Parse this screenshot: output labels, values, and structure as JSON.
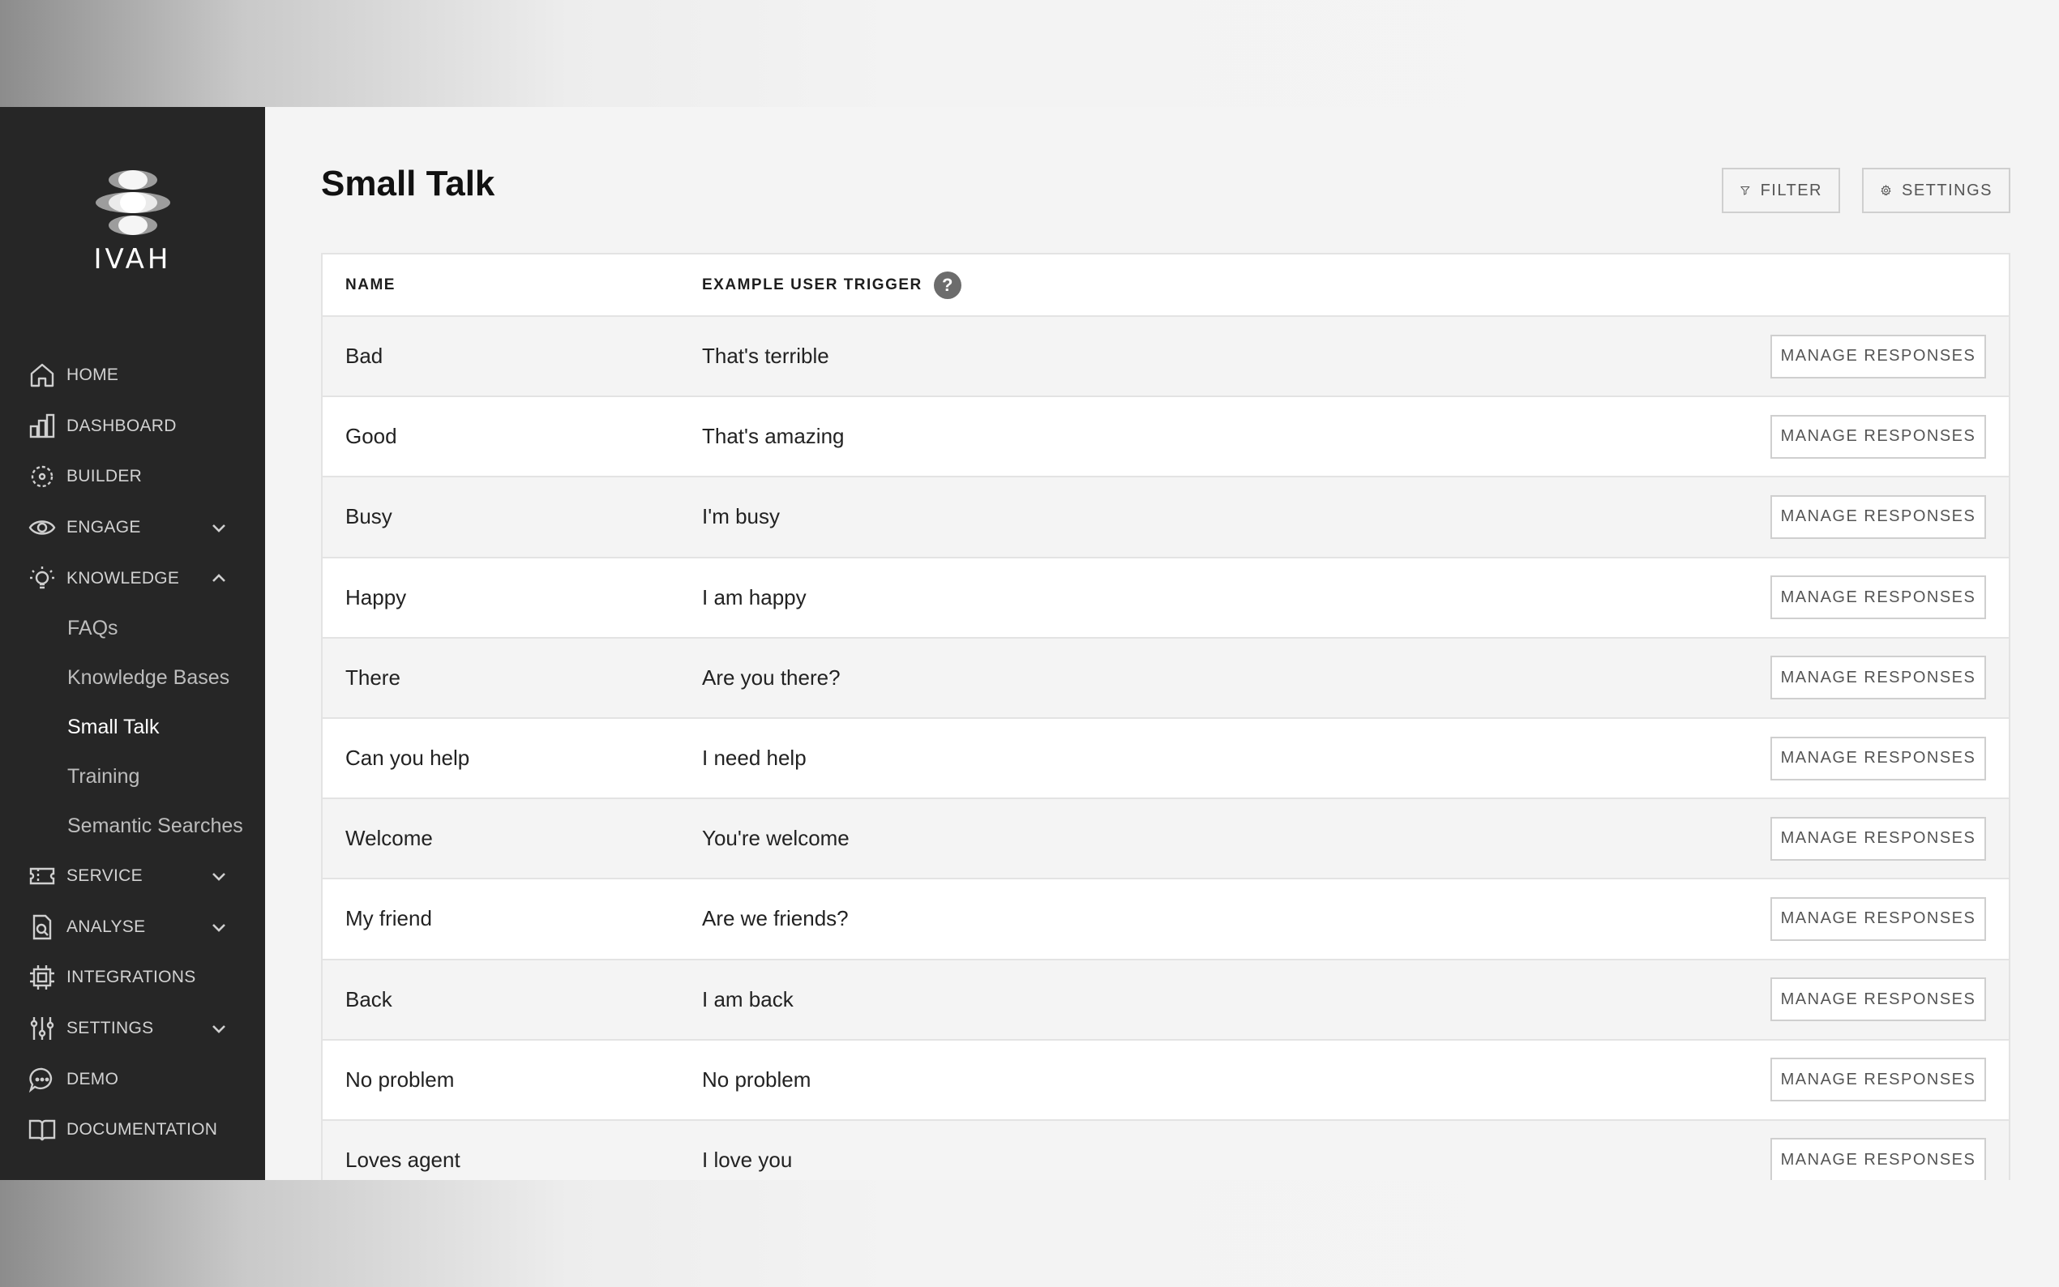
{
  "brand": {
    "name": "IVAH"
  },
  "sidebar": {
    "items": [
      {
        "label": "HOME",
        "icon": "home-icon"
      },
      {
        "label": "DASHBOARD",
        "icon": "bar-chart-icon"
      },
      {
        "label": "BUILDER",
        "icon": "builder-icon"
      },
      {
        "label": "ENGAGE",
        "icon": "eye-icon",
        "expandable": true,
        "expanded": false
      },
      {
        "label": "KNOWLEDGE",
        "icon": "lightbulb-icon",
        "expandable": true,
        "expanded": true
      }
    ],
    "knowledge_children": [
      {
        "label": "FAQs",
        "active": false
      },
      {
        "label": "Knowledge Bases",
        "active": false
      },
      {
        "label": "Small Talk",
        "active": true
      },
      {
        "label": "Training",
        "active": false
      },
      {
        "label": "Semantic Searches",
        "active": false
      }
    ],
    "items_after": [
      {
        "label": "SERVICE",
        "icon": "ticket-icon",
        "expandable": true
      },
      {
        "label": "ANALYSE",
        "icon": "analyse-icon",
        "expandable": true
      },
      {
        "label": "INTEGRATIONS",
        "icon": "chip-icon",
        "expandable": false
      },
      {
        "label": "SETTINGS",
        "icon": "sliders-icon",
        "expandable": true
      },
      {
        "label": "DEMO",
        "icon": "chat-icon",
        "expandable": false
      },
      {
        "label": "DOCUMENTATION",
        "icon": "book-icon",
        "expandable": false
      }
    ]
  },
  "main": {
    "title": "Small Talk",
    "filter_label": "FILTER",
    "settings_label": "SETTINGS",
    "table": {
      "headers": {
        "name": "NAME",
        "trigger": "EXAMPLE USER TRIGGER",
        "help": "?"
      },
      "action_label": "MANAGE RESPONSES",
      "rows": [
        {
          "name": "Bad",
          "trigger": "That's terrible"
        },
        {
          "name": "Good",
          "trigger": "That's amazing"
        },
        {
          "name": "Busy",
          "trigger": "I'm busy"
        },
        {
          "name": "Happy",
          "trigger": "I am happy"
        },
        {
          "name": "There",
          "trigger": "Are you there?"
        },
        {
          "name": "Can you help",
          "trigger": "I need help"
        },
        {
          "name": "Welcome",
          "trigger": "You're welcome"
        },
        {
          "name": "My friend",
          "trigger": "Are we friends?"
        },
        {
          "name": "Back",
          "trigger": "I am back"
        },
        {
          "name": "No problem",
          "trigger": "No problem"
        },
        {
          "name": "Loves agent",
          "trigger": "I love you"
        }
      ]
    }
  },
  "colors": {
    "sidebar_bg": "#262626",
    "page_bg": "#f4f4f4",
    "border": "#e3e3e3"
  }
}
